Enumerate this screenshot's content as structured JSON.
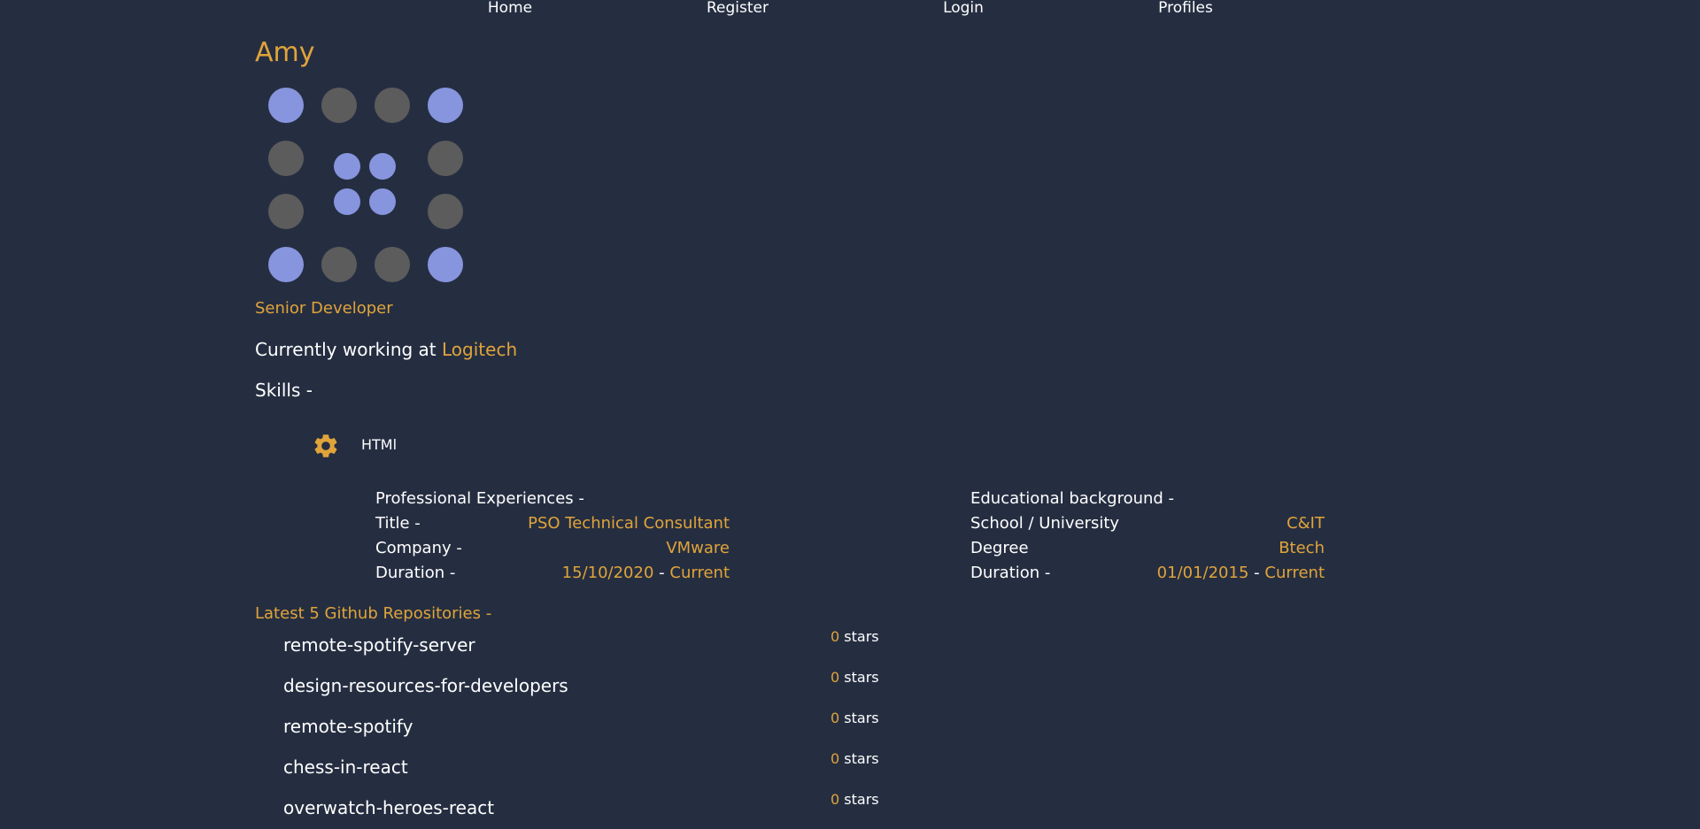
{
  "nav": {
    "home": "Home",
    "register": "Register",
    "login": "Login",
    "profiles": "Profiles"
  },
  "profile": {
    "name": "Amy",
    "role": "Senior Developer",
    "working_prefix": "Currently working at",
    "company": "Logitech",
    "skills_label": "Skills -"
  },
  "skills": [
    {
      "label": "HTMl",
      "icon": "gear-icon"
    }
  ],
  "experience": {
    "heading": "Professional Experiences -",
    "title_label": "Title -",
    "title_value": "PSO Technical Consultant",
    "company_label": "Company -",
    "company_value": "VMware",
    "duration_label": "Duration -",
    "duration_from": "15/10/2020",
    "duration_sep": "-",
    "duration_to": "Current"
  },
  "education": {
    "heading": "Educational background -",
    "school_label": "School / University",
    "school_value": "C&IT",
    "degree_label": "Degree",
    "degree_value": "Btech",
    "duration_label": "Duration -",
    "duration_from": "01/01/2015",
    "duration_sep": "-",
    "duration_to": "Current"
  },
  "repos": {
    "heading": "Latest 5 Github Repositories -",
    "stars_word": "stars",
    "items": [
      {
        "name": "remote-spotify-server",
        "stars": "0"
      },
      {
        "name": "design-resources-for-developers",
        "stars": "0"
      },
      {
        "name": "remote-spotify",
        "stars": "0"
      },
      {
        "name": "chess-in-react",
        "stars": "0"
      },
      {
        "name": "overwatch-heroes-react",
        "stars": "0"
      }
    ]
  },
  "colors": {
    "background": "#252e41",
    "accent": "#e0a43a",
    "avatar_blue": "#8795de",
    "avatar_gray": "#5c5c5c"
  }
}
